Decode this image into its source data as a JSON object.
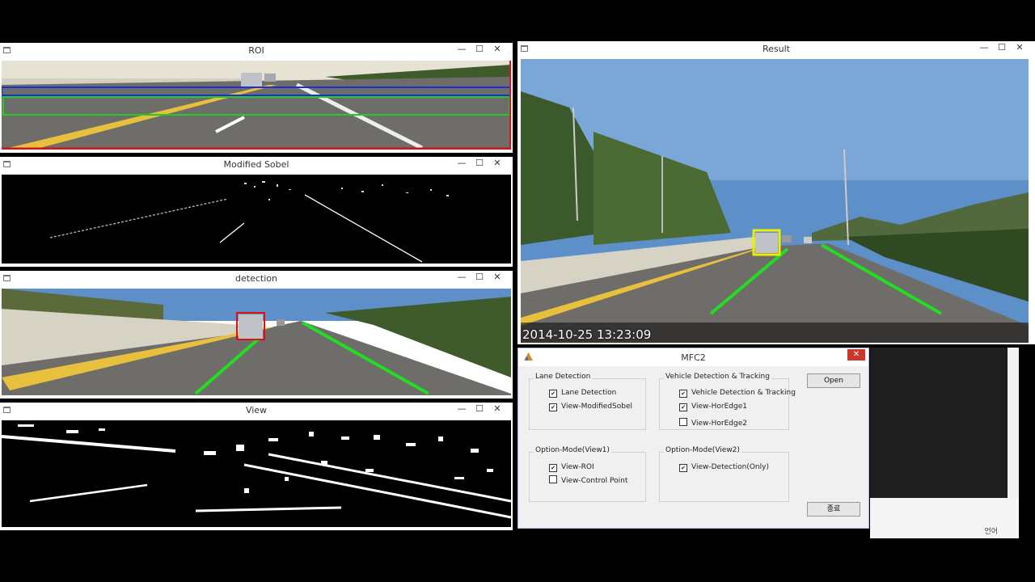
{
  "windows": {
    "roi": {
      "title": "ROI"
    },
    "sobel": {
      "title": "Modified Sobel"
    },
    "detection": {
      "title": "detection"
    },
    "view": {
      "title": "View"
    },
    "result": {
      "title": "Result",
      "timestamp": "2014-10-25 13:23:09"
    }
  },
  "window_controls": {
    "minimize": "—",
    "maximize": "☐",
    "close": "✕"
  },
  "dialog": {
    "title": "MFC2",
    "close_label": "✕",
    "groups": {
      "lane": {
        "label": "Lane Detection",
        "items": [
          {
            "label": "Lane Detection",
            "checked": true
          },
          {
            "label": "View-ModifiedSobel",
            "checked": true
          }
        ]
      },
      "vehicle": {
        "label": "Vehicle Detection & Tracking",
        "items": [
          {
            "label": "Vehicle Detection & Tracking",
            "checked": true
          },
          {
            "label": "View-HorEdge1",
            "checked": true
          },
          {
            "label": "View-HorEdge2",
            "checked": false
          }
        ]
      },
      "view1": {
        "label": "Option-Mode(View1)",
        "items": [
          {
            "label": "View-ROI",
            "checked": true
          },
          {
            "label": "View-Control Point",
            "checked": false
          }
        ]
      },
      "view2": {
        "label": "Option-Mode(View2)",
        "items": [
          {
            "label": "View-Detection(Only)",
            "checked": true
          }
        ]
      }
    },
    "open_button": "Open",
    "exit_button": "종료"
  },
  "console": {
    "footer_text": "언어"
  },
  "colors": {
    "sky": "#5d8fc8",
    "road": "#6b6b6b",
    "lane_marker": "#22dd22",
    "box_red": "#dd1111",
    "box_yellow": "#eeee00",
    "roi_blue": "#1b2fd6",
    "roi_green": "#22cc22",
    "roi_red": "#dd1111"
  }
}
